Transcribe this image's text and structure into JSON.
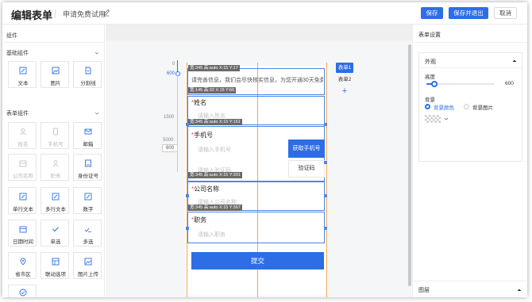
{
  "header": {
    "title": "编辑表单",
    "subtitle": "申请免费试用",
    "save_label": "保存",
    "save_exit_label": "保存并退出",
    "cancel_label": "取消"
  },
  "left_panel": {
    "title": "组件",
    "basic_section": "基础组件",
    "basic_items": [
      "文本",
      "图片",
      "分割线"
    ],
    "form_section": "表单组件",
    "form_items": [
      "姓名",
      "手机号",
      "邮箱",
      "公司名称",
      "职务",
      "身份证号",
      "单行文本",
      "多行文本",
      "数字",
      "日期时间",
      "单选",
      "多选",
      "省市区",
      "联动选项",
      "图片上传"
    ]
  },
  "canvas": {
    "ruler_top": "0",
    "ruler_600": "600",
    "ruler_1500": "1500",
    "ruler_5000": "5000",
    "ruler_600b": "600",
    "tip": "请完善信息，我们会尽快核实信息，为您开通30天免费",
    "dims": {
      "d1": "宽:345 高:auto X:15 Y:17",
      "d2": "宽:145 高:32 X:15 Y:66",
      "d3": "宽:345 高:auto X:15 Y:161",
      "d4": "宽:345 高:auto X:15 Y:301",
      "d5": "宽:345 高:auto X:15 Y:367"
    },
    "fields": {
      "name_label": "姓名",
      "name_placeholder": "请输入姓名",
      "phone_label": "手机号",
      "phone_placeholder": "请输入手机号",
      "get_code_label": "获取手机号",
      "code_placeholder": "请输入验证码",
      "code_label": "验证码",
      "company_label": "公司名称",
      "company_placeholder": "请输入公司名称",
      "job_label": "职务",
      "job_placeholder": "请输入职务",
      "submit_label": "提交"
    },
    "pages": {
      "page1": "表单1",
      "page2": "表单2",
      "add": "+"
    }
  },
  "right_panel": {
    "title": "表单设置",
    "appearance": "外观",
    "height_label": "高度",
    "height_value": "600",
    "height_fraction": 0.12,
    "bg_label": "背景",
    "bg_color_option": "背景颜色",
    "bg_image_option": "背景图片",
    "layers_label": "图层"
  },
  "colors": {
    "accent": "#2d6ee6",
    "guide": "#f0a84a",
    "selection": "#4a86e8"
  }
}
